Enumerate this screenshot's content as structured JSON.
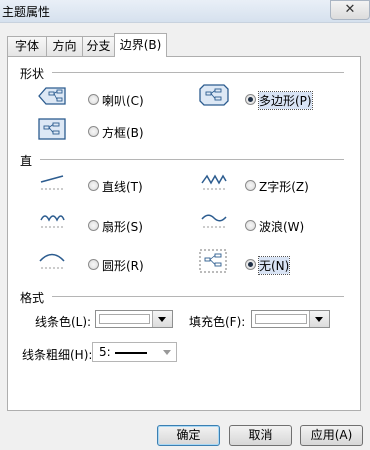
{
  "window": {
    "title": "主题属性",
    "close_glyph": "✕"
  },
  "tabs": [
    {
      "label": "字体"
    },
    {
      "label": "方向"
    },
    {
      "label": "分支"
    },
    {
      "label": "边界(B)"
    }
  ],
  "shape_section": {
    "title": "形状",
    "options": [
      {
        "label": "喇叭(C)",
        "checked": false,
        "icon": "trumpet-shape-icon"
      },
      {
        "label": "多边形(P)",
        "checked": true,
        "icon": "polygon-shape-icon"
      },
      {
        "label": "方框(B)",
        "checked": false,
        "icon": "box-shape-icon"
      }
    ]
  },
  "line_section": {
    "title": "直",
    "options": [
      {
        "label": "直线(T)",
        "checked": false,
        "icon": "straight-line-icon"
      },
      {
        "label": "Z字形(Z)",
        "checked": false,
        "icon": "zigzag-line-icon"
      },
      {
        "label": "扇形(S)",
        "checked": false,
        "icon": "scallop-line-icon"
      },
      {
        "label": "波浪(W)",
        "checked": false,
        "icon": "wave-line-icon"
      },
      {
        "label": "圆形(R)",
        "checked": false,
        "icon": "arc-line-icon"
      },
      {
        "label": "无(N)",
        "checked": true,
        "icon": "no-line-icon"
      }
    ]
  },
  "format_section": {
    "title": "格式",
    "line_color_label": "线条色(L):",
    "fill_color_label": "填充色(F):",
    "line_width_label": "线条粗细(H):",
    "line_width_value": "5:"
  },
  "buttons": {
    "ok": "确定",
    "cancel": "取消",
    "apply": "应用(A)"
  },
  "colors": {
    "selection_bg": "#d9e4f5",
    "icon_blue": "#2c5c8f",
    "icon_fill": "#dde8f5"
  }
}
